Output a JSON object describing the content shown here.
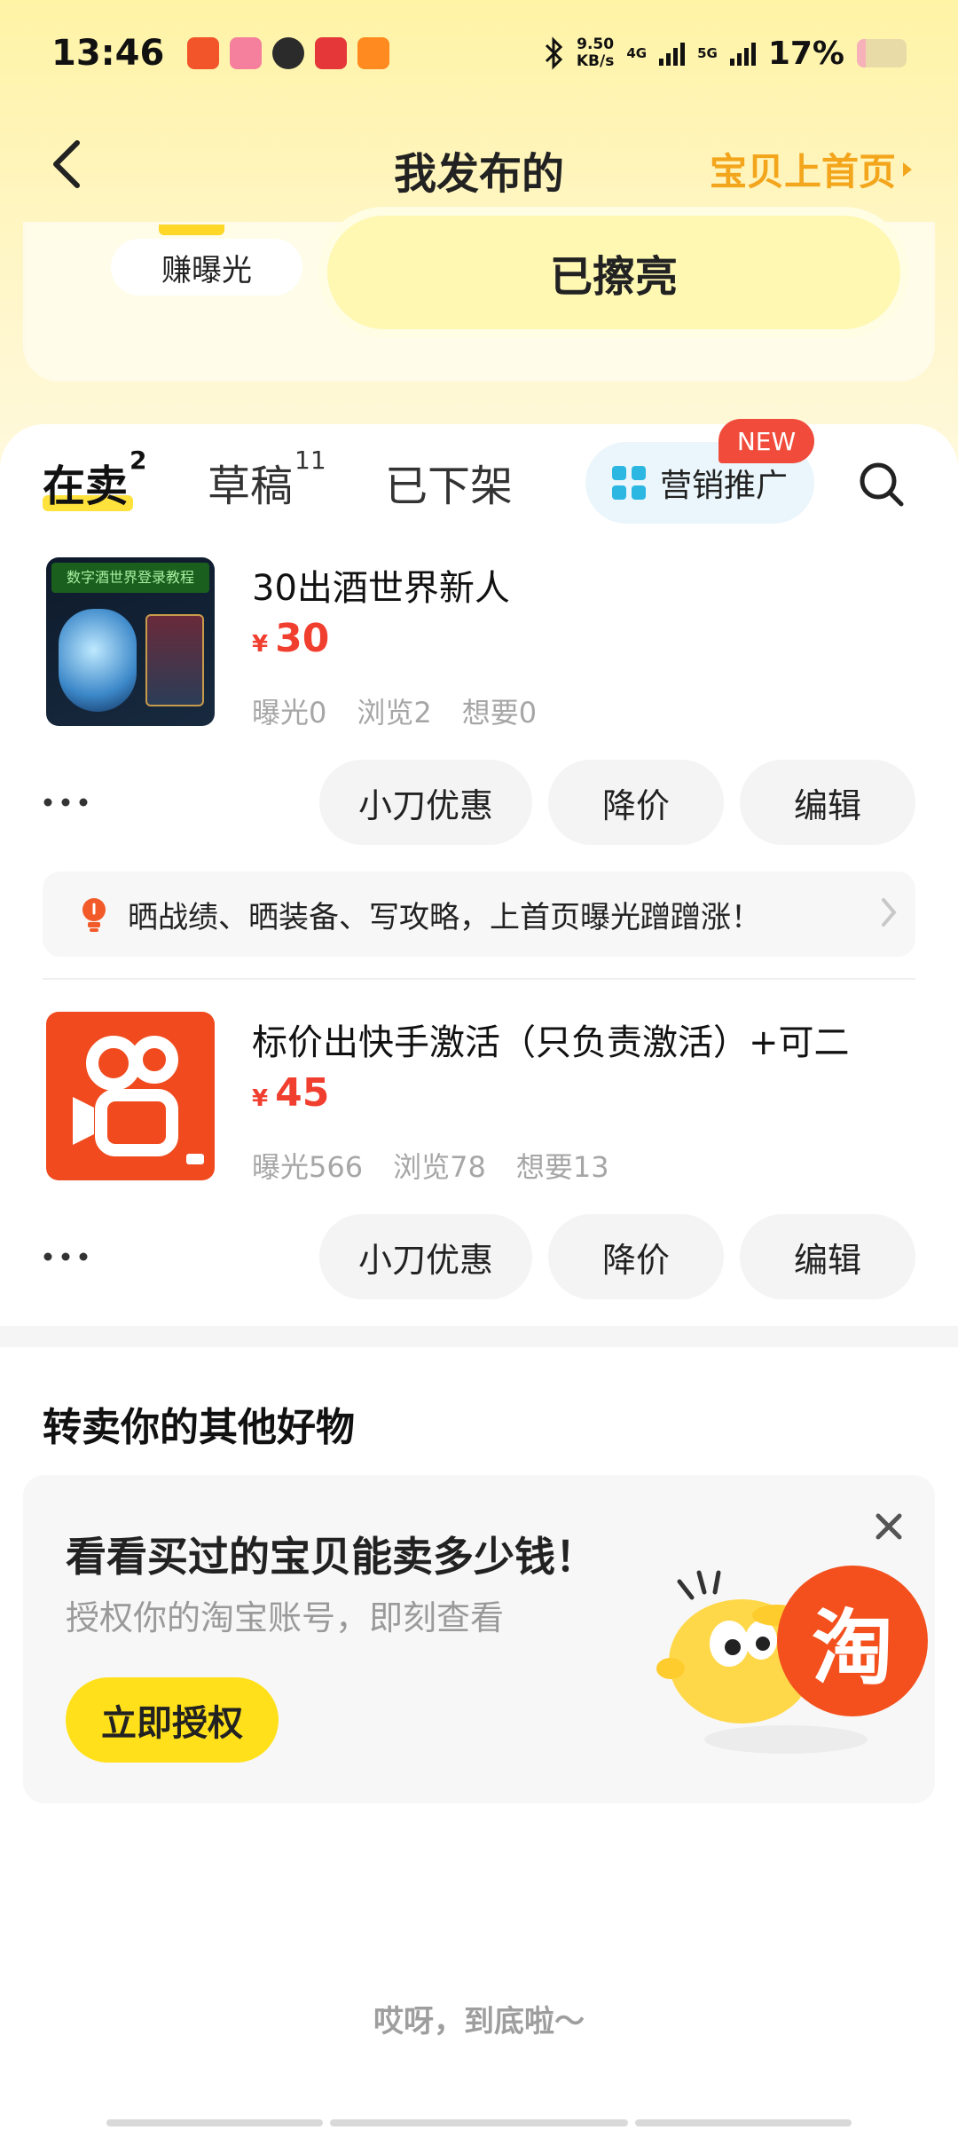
{
  "status_bar": {
    "time": "13:46",
    "net_speed_value": "9.50",
    "net_speed_unit": "KB/s",
    "signal_1": "4G",
    "signal_2": "5G",
    "battery": "17%"
  },
  "nav": {
    "title": "我发布的",
    "home_link": "宝贝上首页"
  },
  "promo": {
    "left_label": "赚曝光",
    "right_label": "已擦亮"
  },
  "tabs": {
    "selling": "在卖",
    "selling_count": "2",
    "drafts": "草稿",
    "drafts_count": "11",
    "off_shelf": "已下架",
    "promotion": "营销推广",
    "new_badge": "NEW"
  },
  "items": [
    {
      "title": "30出酒世界新人",
      "currency": "¥",
      "price": "30",
      "exposure": "曝光0",
      "views": "浏览2",
      "wants": "想要0",
      "thumb_banner": "数字酒世界登录教程",
      "actions": [
        "小刀优惠",
        "降价",
        "编辑"
      ],
      "tip": "晒战绩、晒装备、写攻略，上首页曝光蹭蹭涨！"
    },
    {
      "title": "标价出快手激活（只负责激活）+可二",
      "currency": "¥",
      "price": "45",
      "exposure": "曝光566",
      "views": "浏览78",
      "wants": "想要13",
      "actions": [
        "小刀优惠",
        "降价",
        "编辑"
      ]
    }
  ],
  "resell": {
    "section_title": "转卖你的其他好物",
    "card_title": "看看买过的宝贝能卖多少钱！",
    "card_subtitle": "授权你的淘宝账号，即刻查看",
    "auth_button": "立即授权",
    "mascot_badge": "淘"
  },
  "footer": {
    "end_text": "哎呀，到底啦～"
  },
  "colors": {
    "accent_yellow": "#ffe01a",
    "price_red": "#f03e2f",
    "home_link_orange": "#f3a51c",
    "kuaishou_orange": "#f04a1e"
  }
}
